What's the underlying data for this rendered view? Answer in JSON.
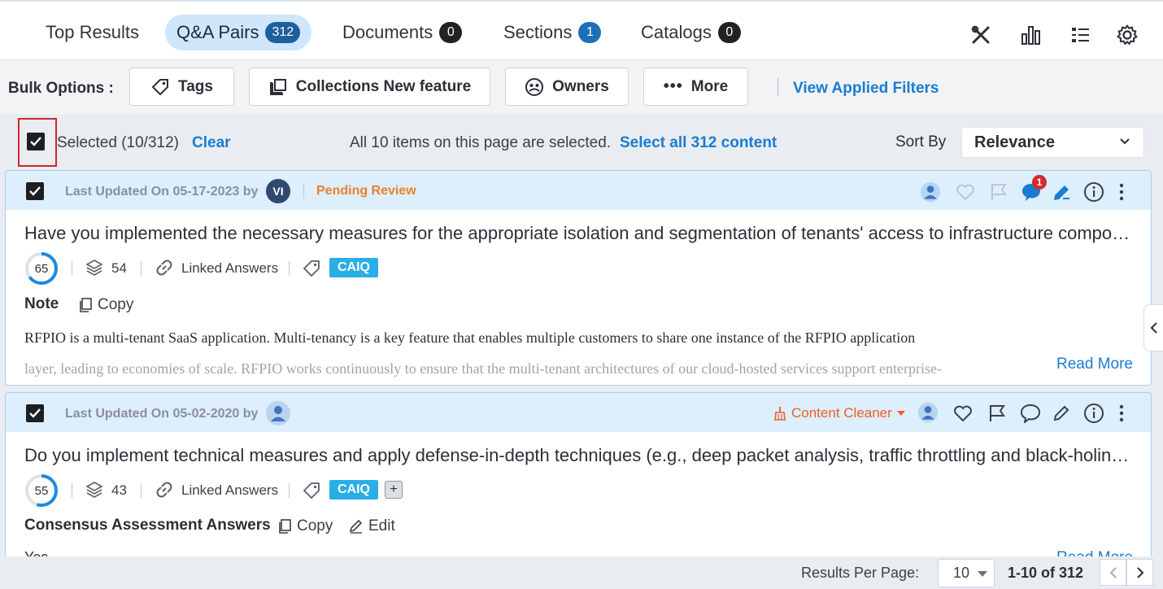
{
  "tabs": [
    {
      "label": "Top Results",
      "count": ""
    },
    {
      "label": "Q&A Pairs",
      "count": "312"
    },
    {
      "label": "Documents",
      "count": "0"
    },
    {
      "label": "Sections",
      "count": "1"
    },
    {
      "label": "Catalogs",
      "count": "0"
    }
  ],
  "bulk": {
    "label": "Bulk Options :",
    "tags": "Tags",
    "collections": "Collections New feature",
    "owners": "Owners",
    "more": "More",
    "view_filters": "View Applied Filters"
  },
  "selection": {
    "selected": "Selected (10/312)",
    "clear": "Clear",
    "message": "All 10 items on this page are selected.",
    "select_all": "Select all 312 content",
    "sort_label": "Sort By",
    "sort_value": "Relevance"
  },
  "cards": [
    {
      "updated": "Last Updated On 05-17-2023 by",
      "avatar_initials": "VI",
      "status": "Pending Review",
      "comment_count": "1",
      "title": "Have you implemented the necessary measures for the appropriate isolation and segmentation of tenants' access to infrastructure components?",
      "score": 65,
      "versions": "54",
      "linked": "Linked Answers",
      "tag": "CAIQ",
      "note_label": "Note",
      "copy": "Copy",
      "answer_line1": "RFPIO is a multi-tenant SaaS application. Multi-tenancy is a key feature that enables multiple customers to share one instance of the RFPIO application",
      "answer_line2": "layer, leading to economies of scale. RFPIO works continuously to ensure that the multi-tenant architectures of our cloud-hosted services support enterprise-",
      "read_more": "Read More"
    },
    {
      "updated": "Last Updated On 05-02-2020 by",
      "status": "Content Cleaner",
      "title": "Do you implement technical measures and apply defense-in-depth techniques (e.g., deep packet analysis, traffic throttling and black-holing)?",
      "score": 55,
      "versions": "43",
      "linked": "Linked Answers",
      "tag": "CAIQ",
      "plus": "+",
      "note_label": "Consensus Assessment Answers",
      "copy": "Copy",
      "edit": "Edit",
      "answer_line1": "Yes",
      "read_more": "Read More"
    }
  ],
  "pagination": {
    "label": "Results Per Page:",
    "per_page": "10",
    "range": "1-10 of 312"
  },
  "colors": {
    "accent": "#1b7ccf",
    "active_tab": "#cfe6fb",
    "card_header": "#ddeefc",
    "tag": "#29aee6",
    "pending": "#e8812a",
    "cleaner": "#e8602a"
  }
}
